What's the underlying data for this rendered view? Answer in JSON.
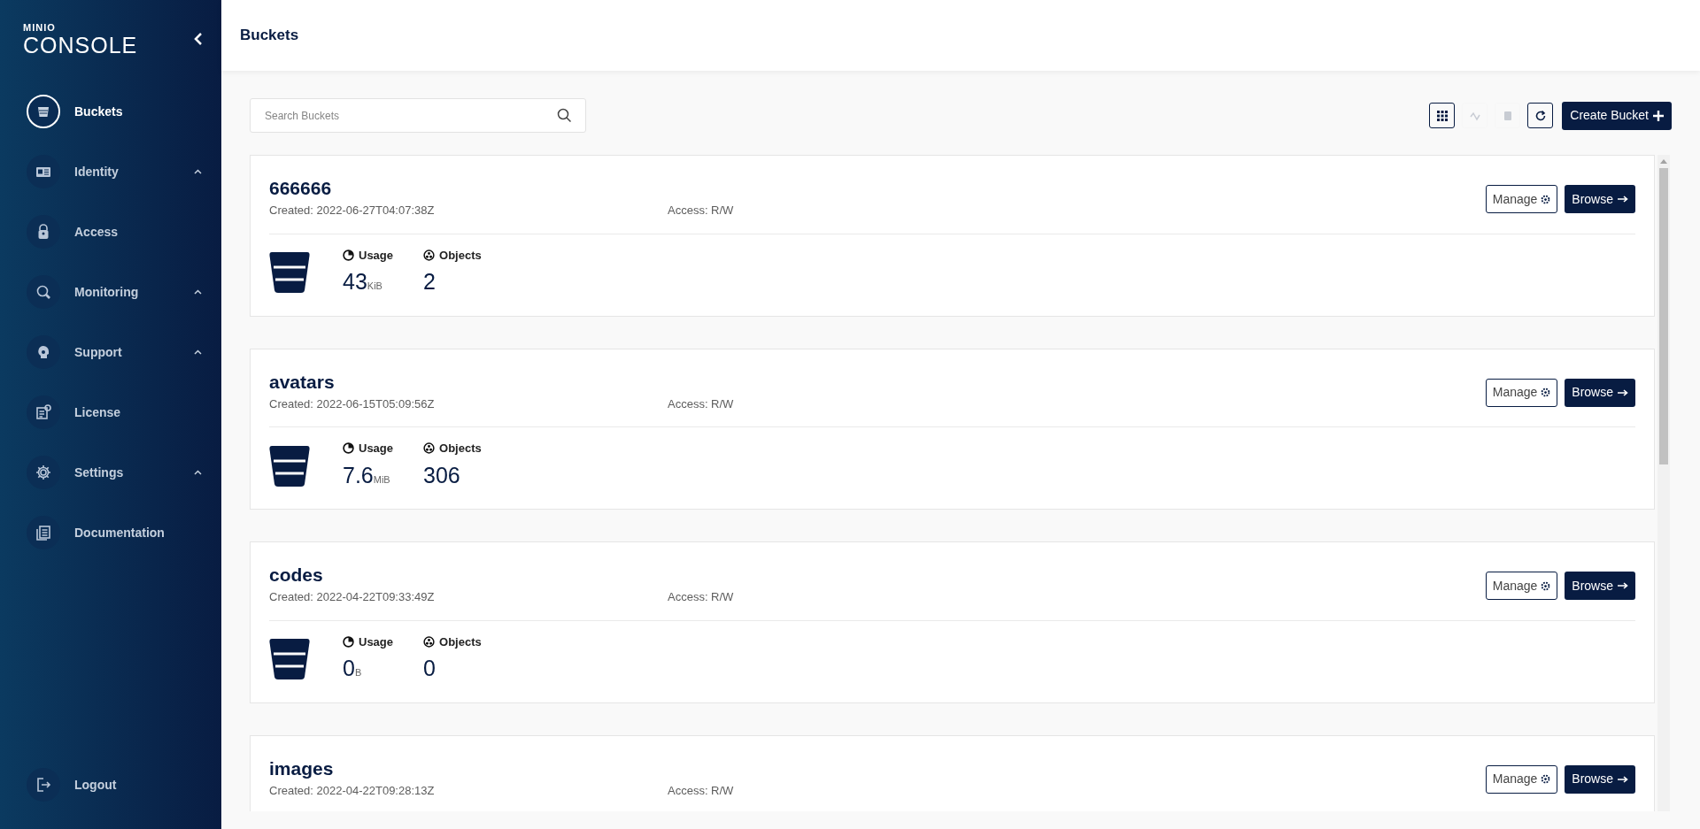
{
  "sidebar": {
    "logo": {
      "brand": "MINIO",
      "product": "CONSOLE"
    },
    "items": [
      {
        "label": "Buckets",
        "selected": true,
        "expandable": false
      },
      {
        "label": "Identity",
        "selected": false,
        "expandable": true
      },
      {
        "label": "Access",
        "selected": false,
        "expandable": false
      },
      {
        "label": "Monitoring",
        "selected": false,
        "expandable": true
      },
      {
        "label": "Support",
        "selected": false,
        "expandable": true
      },
      {
        "label": "License",
        "selected": false,
        "expandable": false
      },
      {
        "label": "Settings",
        "selected": false,
        "expandable": true
      },
      {
        "label": "Documentation",
        "selected": false,
        "expandable": false
      }
    ],
    "logout": {
      "label": "Logout"
    }
  },
  "header": {
    "title": "Buckets"
  },
  "search": {
    "placeholder": "Search Buckets"
  },
  "toolbar": {
    "icon_buttons": [
      {
        "disabled": false
      },
      {
        "disabled": true
      },
      {
        "disabled": true
      },
      {
        "disabled": false
      }
    ],
    "create_button": "Create Bucket"
  },
  "buckets": [
    {
      "name": "666666",
      "created": "Created: 2022-06-27T04:07:38Z",
      "access": "Access: R/W",
      "usage_label": "Usage",
      "usage": "43",
      "usage_unit": "KiB",
      "objects_label": "Objects",
      "objects": "2",
      "manage": "Manage",
      "browse": "Browse"
    },
    {
      "name": "avatars",
      "created": "Created: 2022-06-15T05:09:56Z",
      "access": "Access: R/W",
      "usage_label": "Usage",
      "usage": "7.6",
      "usage_unit": "MiB",
      "objects_label": "Objects",
      "objects": "306",
      "manage": "Manage",
      "browse": "Browse"
    },
    {
      "name": "codes",
      "created": "Created: 2022-04-22T09:33:49Z",
      "access": "Access: R/W",
      "usage_label": "Usage",
      "usage": "0",
      "usage_unit": "B",
      "objects_label": "Objects",
      "objects": "0",
      "manage": "Manage",
      "browse": "Browse"
    },
    {
      "name": "images",
      "created": "Created: 2022-04-22T09:28:13Z",
      "access": "Access: R/W",
      "manage": "Manage",
      "browse": "Browse"
    }
  ]
}
